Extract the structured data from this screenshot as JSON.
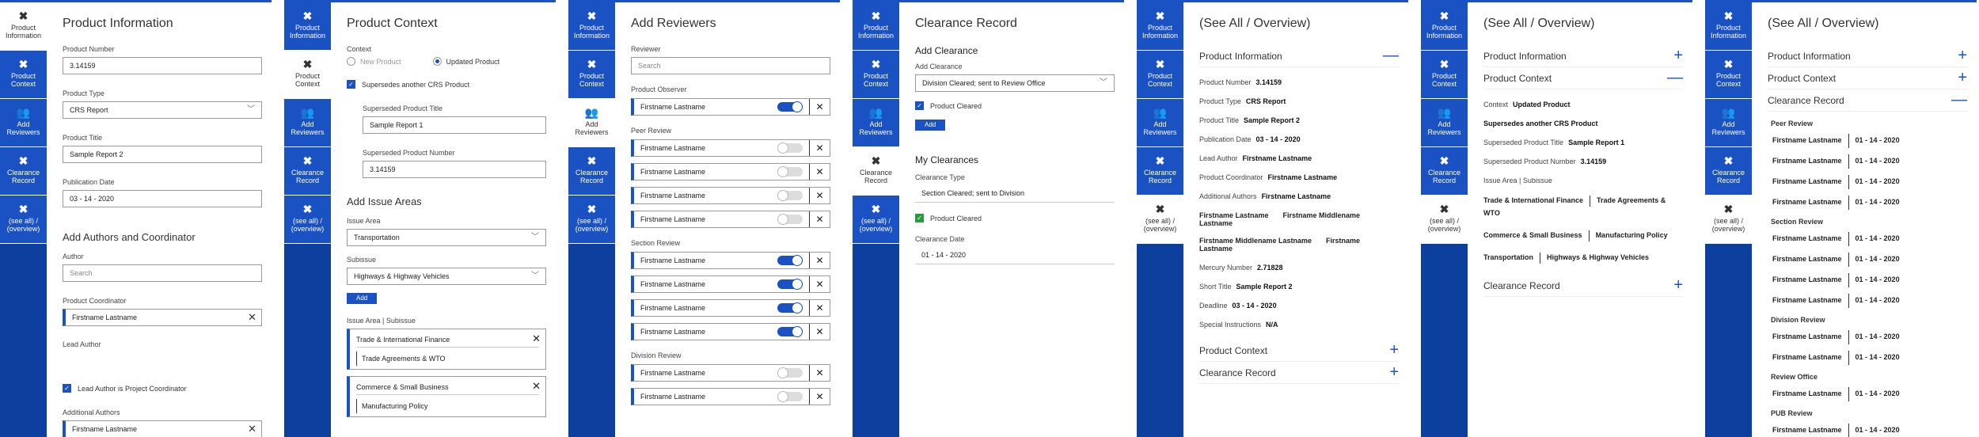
{
  "nav": [
    {
      "label": "Product Information",
      "icon": "close-icon"
    },
    {
      "label": "Product Context",
      "icon": "close-icon"
    },
    {
      "label": "Add Reviewers",
      "icon": "users-icon"
    },
    {
      "label": "Clearance Record",
      "icon": "close-icon"
    },
    {
      "label": "(see all) / (overview)",
      "icon": "close-icon"
    }
  ],
  "panel1": {
    "title": "Product Information",
    "product_number_label": "Product Number",
    "product_number": "3.14159",
    "product_type_label": "Product Type",
    "product_type": "CRS Report",
    "product_title_label": "Product Title",
    "product_title": "Sample Report 2",
    "publication_date_label": "Publication Date",
    "publication_date": "03  -  14 - 2020",
    "authors_title": "Add Authors and Coordinator",
    "author_label": "Author",
    "author_placeholder": "Search",
    "coordinator_label": "Product Coordinator",
    "coordinator": "Firstname Lastname",
    "lead_author_label": "Lead Author",
    "lead_is_coordinator": "Lead Author is Project Coordinator",
    "additional_authors_label": "Additional Authors",
    "additional_author": "Firstname Lastname"
  },
  "panel2": {
    "title": "Product Context",
    "context_label": "Context",
    "new_product": "New Product",
    "updated_product": "Updated Product",
    "supersedes": "Supersedes another CRS Product",
    "superseded_title_label": "Superseded Product Title",
    "superseded_title": "Sample Report 1",
    "superseded_number_label": "Superseded Product Number",
    "superseded_number": "3.14159",
    "issue_title": "Add Issue Areas",
    "issue_area_label": "Issue Area",
    "issue_area": "Transportation",
    "subissue_label": "Subissue",
    "subissue": "Highways & Highway Vehicles",
    "add_label": "Add",
    "issue_list_label": "Issue Area | Subissue",
    "items": [
      {
        "area": "Trade & International Finance",
        "sub": "Trade Agreements & WTO"
      },
      {
        "area": "Commerce & Small Business",
        "sub": "Manufacturing Policy"
      }
    ]
  },
  "panel3": {
    "title": "Add Reviewers",
    "reviewer_label": "Reviewer",
    "reviewer_placeholder": "Search",
    "groups": [
      {
        "label": "Product Observer",
        "rows": [
          {
            "name": "Firstname Lastname",
            "on": true
          }
        ]
      },
      {
        "label": "Peer Review",
        "rows": [
          {
            "name": "Firstname Lastname",
            "on": false
          },
          {
            "name": "Firstname Lastname",
            "on": false
          },
          {
            "name": "Firstname Lastname",
            "on": false
          },
          {
            "name": "Firstname Lastname",
            "on": false
          }
        ]
      },
      {
        "label": "Section Review",
        "rows": [
          {
            "name": "Firstname Lastname",
            "on": true
          },
          {
            "name": "Firstname Lastname",
            "on": true
          },
          {
            "name": "Firstname Lastname",
            "on": true
          },
          {
            "name": "Firstname Lastname",
            "on": true
          }
        ]
      },
      {
        "label": "Division Review",
        "rows": [
          {
            "name": "Firstname Lastname",
            "on": false
          },
          {
            "name": "Firstname Lastname",
            "on": false
          }
        ]
      }
    ]
  },
  "panel4": {
    "title": "Clearance Record",
    "add_title": "Add Clearance",
    "add_label": "Add Clearance",
    "add_value": "Division Cleared; sent to Review Office",
    "product_cleared": "Product Cleared",
    "add_button": "Add",
    "my_title": "My Clearances",
    "type_label": "Clearance Type",
    "type_value": "Section Cleared; sent to Division",
    "cleared": "Product Cleared",
    "date_label": "Clearance Date",
    "date_value": "01  -  14 - 2020"
  },
  "overview": {
    "title": "(See All / Overview)",
    "product_information": "Product Information",
    "product_context": "Product Context",
    "clearance_record": "Clearance Record",
    "info": [
      {
        "k": "Product Number",
        "v": "3.14159"
      },
      {
        "k": "Product Type",
        "v": "CRS Report"
      },
      {
        "k": "Product Title",
        "v": "Sample Report 2"
      },
      {
        "k": "Publication Date",
        "v": "03  -  14 - 2020"
      },
      {
        "k": "Lead Author",
        "v": "Firstname Lastname"
      },
      {
        "k": "Product Coordinator",
        "v": "Firstname Lastname"
      },
      {
        "k": "Additional Authors",
        "v": "Firstname Lastname"
      }
    ],
    "names1": [
      "Firstname Lastname",
      "Firstname Middlename Lastname"
    ],
    "names2": [
      "Firstname Middlename Lastname",
      "Firstname Lastname"
    ],
    "info2": [
      {
        "k": "Mercury Number",
        "v": "2.71828"
      },
      {
        "k": "Short Title",
        "v": "Sample Report 2"
      },
      {
        "k": "Deadline",
        "v": "03  -  14 - 2020"
      },
      {
        "k": "Special Instructions",
        "v": "N/A"
      }
    ],
    "context_label": "Context",
    "context_value": "Updated Product",
    "supersedes": "Supersedes another CRS Product",
    "superseded_title_label": "Superseded Product Title",
    "superseded_title": "Sample Report 1",
    "superseded_number_label": "Superseded Product Number",
    "superseded_number": "3.14159",
    "issue_list_label": "Issue Area | Subissue",
    "issues": [
      [
        "Trade & International Finance",
        "Trade Agreements & WTO"
      ],
      [
        "Commerce & Small Business",
        "Manufacturing Policy"
      ],
      [
        "Transportation",
        "Highways & Highway Vehicles"
      ]
    ],
    "cr_groups": [
      {
        "label": "Peer Review",
        "rows": [
          "01 - 14 - 2020",
          "01 - 14 - 2020",
          "01 - 14 - 2020",
          "01 - 14 - 2020"
        ]
      },
      {
        "label": "Section Review",
        "rows": [
          "01 - 14 - 2020",
          "01 - 14 - 2020",
          "01 - 14 - 2020",
          "01 - 14 - 2020"
        ]
      },
      {
        "label": "Division Review",
        "rows": [
          "01 - 14 - 2020",
          "01 - 14 - 2020"
        ]
      },
      {
        "label": "Review Office",
        "rows": [
          "01 - 14 - 2020"
        ]
      },
      {
        "label": "PUB Review",
        "rows": [
          "01 - 14 - 2020"
        ]
      }
    ],
    "cr_name": "Firstname Lastname"
  }
}
